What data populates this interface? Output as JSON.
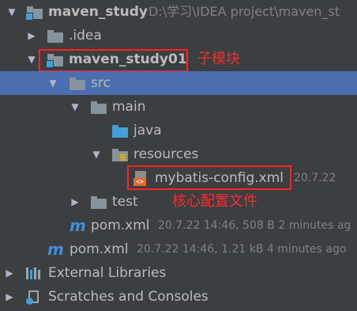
{
  "tree": {
    "root": {
      "label": "maven_study",
      "path": "D:\\学习\\IDEA project\\maven_st"
    },
    "idea": {
      "label": ".idea"
    },
    "module": {
      "label": "maven_study01",
      "annotation": "子模块"
    },
    "src": {
      "label": "src"
    },
    "main": {
      "label": "main"
    },
    "java": {
      "label": "java"
    },
    "resources": {
      "label": "resources"
    },
    "config_file": {
      "label": "mybatis-config.xml",
      "meta": "20.7.22",
      "annotation": "核心配置文件"
    },
    "test": {
      "label": "test"
    },
    "module_pom": {
      "label": "pom.xml",
      "meta": "20.7.22 14:46, 508 B 2 minutes ag"
    },
    "root_pom": {
      "label": "pom.xml",
      "meta": "20.7.22 14:46, 1.21 kB 4 minutes ago"
    },
    "external_libraries": {
      "label": "External Libraries"
    },
    "scratches": {
      "label": "Scratches and Consoles"
    }
  },
  "icons": {
    "arrow_expanded": "▼",
    "arrow_collapsed": "▶",
    "maven": "m"
  },
  "colors": {
    "background": "#3c3f41",
    "selection": "#4b6eaf",
    "annotation": "#ff2020",
    "folder_blue": "#41a0d6"
  }
}
